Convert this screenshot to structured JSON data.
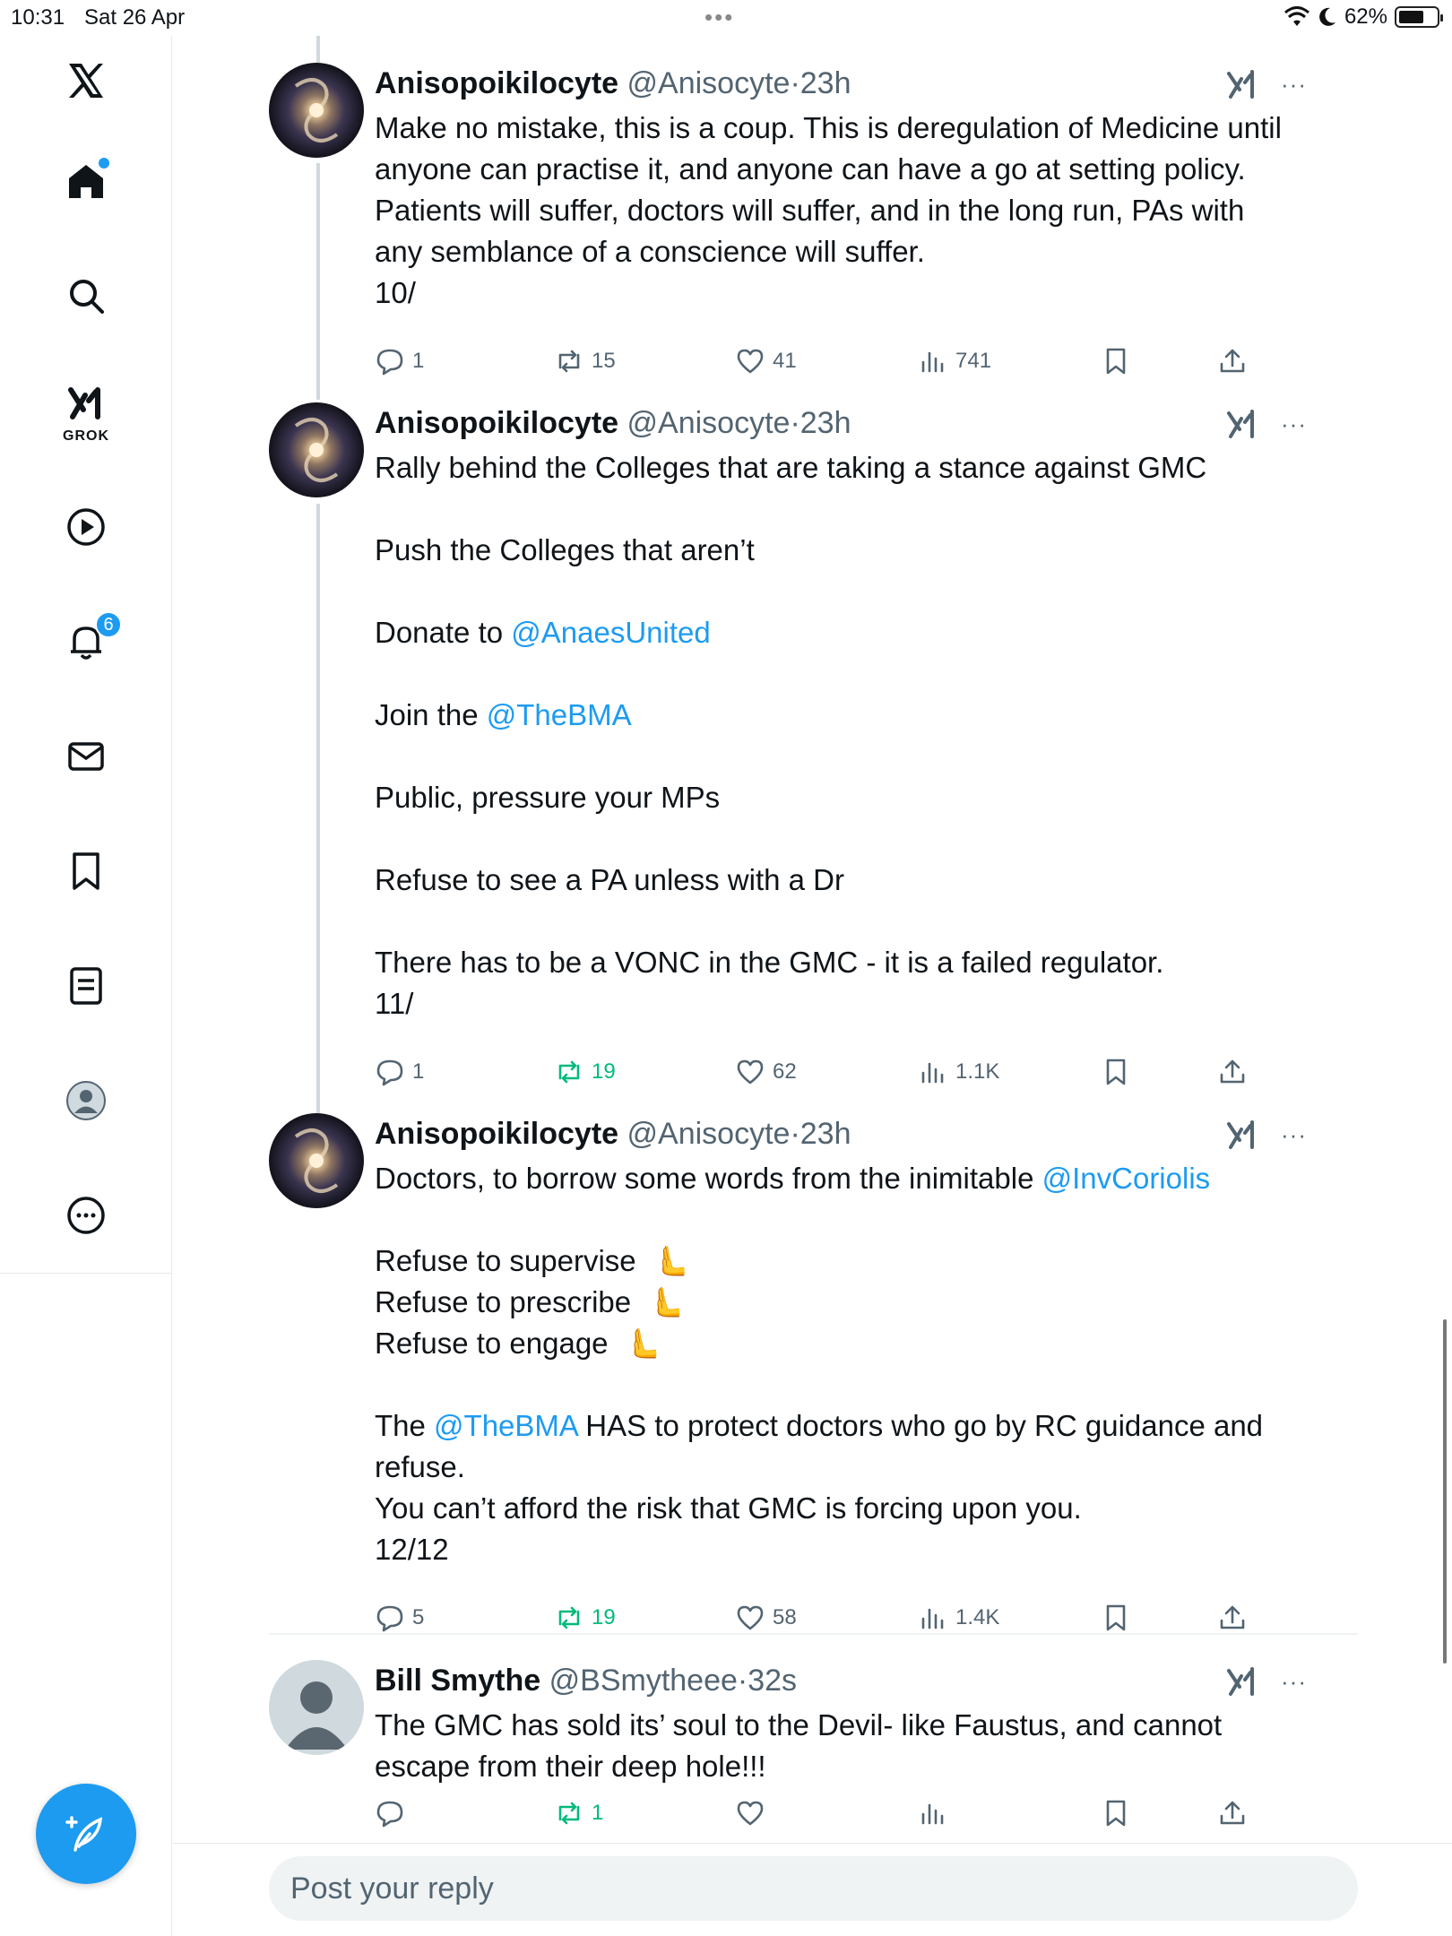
{
  "status_bar": {
    "time": "10:31",
    "date": "Sat 26 Apr",
    "battery": "62%",
    "battery_level": 0.62
  },
  "sidebar": {
    "items": [
      {
        "name": "x-logo",
        "icon": "x-logo-icon"
      },
      {
        "name": "home",
        "icon": "home-icon",
        "has_dot": true
      },
      {
        "name": "explore",
        "icon": "search-icon"
      },
      {
        "name": "grok",
        "icon": "grok-icon",
        "label": "GROK"
      },
      {
        "name": "video",
        "icon": "play-icon"
      },
      {
        "name": "notifications",
        "icon": "bell-icon",
        "badge": "6"
      },
      {
        "name": "messages",
        "icon": "mail-icon"
      },
      {
        "name": "bookmarks",
        "icon": "bookmark-icon"
      },
      {
        "name": "lists",
        "icon": "list-icon"
      },
      {
        "name": "profile",
        "icon": "avatar-icon"
      },
      {
        "name": "more",
        "icon": "more-circle-icon"
      }
    ],
    "compose_icon": "feather-plus-icon"
  },
  "tweets": [
    {
      "name": "Anisopoikilocyte",
      "handle": "@Anisocyte",
      "time": "23h",
      "lines": [
        "Make no mistake, this is a coup. This is deregulation of Medicine until",
        "anyone can practise it, and anyone can have a go at setting policy.",
        "Patients will suffer, doctors will suffer, and in the long run, PAs with",
        "any semblance of a conscience will suffer.",
        "10/"
      ],
      "replies": "1",
      "reposts": "15",
      "likes": "41",
      "views": "741"
    },
    {
      "name": "Anisopoikilocyte",
      "handle": "@Anisocyte",
      "time": "23h",
      "p1": "Rally behind the Colleges that are taking a stance against GMC",
      "p2": "Push the Colleges that aren’t",
      "p3_pre": "Donate to ",
      "p3_mention": "@AnaesUnited",
      "p4_pre": "Join the ",
      "p4_mention": "@TheBMA",
      "p5": "Public, pressure your MPs",
      "p6": "Refuse to see a PA unless with a Dr",
      "p7a": "There has to be a VONC in the GMC - it is a failed regulator.",
      "p7b": "11/",
      "replies": "1",
      "reposts": "19",
      "likes": "62",
      "views": "1.1K"
    },
    {
      "name": "Anisopoikilocyte",
      "handle": "@Anisocyte",
      "time": "23h",
      "p1_pre": "Doctors, to borrow some words from the inimitable ",
      "p1_mention": "@InvCoriolis",
      "l1": "Refuse to supervise",
      "l2": "Refuse to prescribe",
      "l3": "Refuse to engage",
      "hand_emoji": "🫷",
      "p3_pre": "The ",
      "p3_mention": "@TheBMA",
      "p3_post": " HAS to protect doctors who go by RC guidance and",
      "p3_line2": "refuse.",
      "p4": "You can’t afford the risk that GMC is forcing upon you.",
      "p5": "12/12",
      "replies": "5",
      "reposts": "19",
      "likes": "58",
      "views": "1.4K"
    },
    {
      "name": "Bill Smythe",
      "handle": "@BSmytheee",
      "time": "32s",
      "lines": [
        "The GMC has sold its’ soul to the Devil- like Faustus, and cannot",
        "escape from their deep hole!!!"
      ],
      "reposts": "1"
    }
  ],
  "reply_box": {
    "placeholder": "Post your reply"
  },
  "colors": {
    "accent": "#1d9bf0",
    "repost_active": "#00ba7c",
    "muted": "#536471"
  }
}
